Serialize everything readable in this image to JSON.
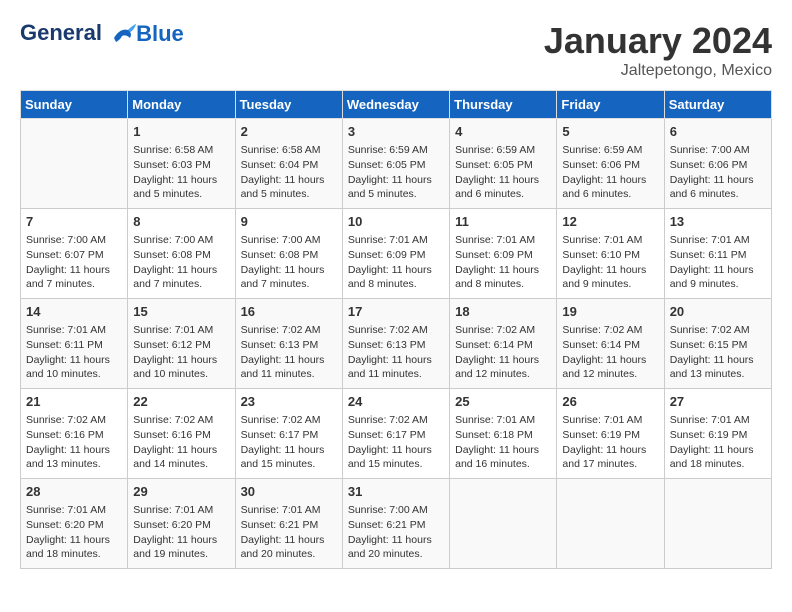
{
  "header": {
    "logo_line1": "General",
    "logo_line2": "Blue",
    "month": "January 2024",
    "location": "Jaltepetongo, Mexico"
  },
  "weekdays": [
    "Sunday",
    "Monday",
    "Tuesday",
    "Wednesday",
    "Thursday",
    "Friday",
    "Saturday"
  ],
  "weeks": [
    [
      {
        "day": "",
        "detail": ""
      },
      {
        "day": "1",
        "detail": "Sunrise: 6:58 AM\nSunset: 6:03 PM\nDaylight: 11 hours\nand 5 minutes."
      },
      {
        "day": "2",
        "detail": "Sunrise: 6:58 AM\nSunset: 6:04 PM\nDaylight: 11 hours\nand 5 minutes."
      },
      {
        "day": "3",
        "detail": "Sunrise: 6:59 AM\nSunset: 6:05 PM\nDaylight: 11 hours\nand 5 minutes."
      },
      {
        "day": "4",
        "detail": "Sunrise: 6:59 AM\nSunset: 6:05 PM\nDaylight: 11 hours\nand 6 minutes."
      },
      {
        "day": "5",
        "detail": "Sunrise: 6:59 AM\nSunset: 6:06 PM\nDaylight: 11 hours\nand 6 minutes."
      },
      {
        "day": "6",
        "detail": "Sunrise: 7:00 AM\nSunset: 6:06 PM\nDaylight: 11 hours\nand 6 minutes."
      }
    ],
    [
      {
        "day": "7",
        "detail": "Sunrise: 7:00 AM\nSunset: 6:07 PM\nDaylight: 11 hours\nand 7 minutes."
      },
      {
        "day": "8",
        "detail": "Sunrise: 7:00 AM\nSunset: 6:08 PM\nDaylight: 11 hours\nand 7 minutes."
      },
      {
        "day": "9",
        "detail": "Sunrise: 7:00 AM\nSunset: 6:08 PM\nDaylight: 11 hours\nand 7 minutes."
      },
      {
        "day": "10",
        "detail": "Sunrise: 7:01 AM\nSunset: 6:09 PM\nDaylight: 11 hours\nand 8 minutes."
      },
      {
        "day": "11",
        "detail": "Sunrise: 7:01 AM\nSunset: 6:09 PM\nDaylight: 11 hours\nand 8 minutes."
      },
      {
        "day": "12",
        "detail": "Sunrise: 7:01 AM\nSunset: 6:10 PM\nDaylight: 11 hours\nand 9 minutes."
      },
      {
        "day": "13",
        "detail": "Sunrise: 7:01 AM\nSunset: 6:11 PM\nDaylight: 11 hours\nand 9 minutes."
      }
    ],
    [
      {
        "day": "14",
        "detail": "Sunrise: 7:01 AM\nSunset: 6:11 PM\nDaylight: 11 hours\nand 10 minutes."
      },
      {
        "day": "15",
        "detail": "Sunrise: 7:01 AM\nSunset: 6:12 PM\nDaylight: 11 hours\nand 10 minutes."
      },
      {
        "day": "16",
        "detail": "Sunrise: 7:02 AM\nSunset: 6:13 PM\nDaylight: 11 hours\nand 11 minutes."
      },
      {
        "day": "17",
        "detail": "Sunrise: 7:02 AM\nSunset: 6:13 PM\nDaylight: 11 hours\nand 11 minutes."
      },
      {
        "day": "18",
        "detail": "Sunrise: 7:02 AM\nSunset: 6:14 PM\nDaylight: 11 hours\nand 12 minutes."
      },
      {
        "day": "19",
        "detail": "Sunrise: 7:02 AM\nSunset: 6:14 PM\nDaylight: 11 hours\nand 12 minutes."
      },
      {
        "day": "20",
        "detail": "Sunrise: 7:02 AM\nSunset: 6:15 PM\nDaylight: 11 hours\nand 13 minutes."
      }
    ],
    [
      {
        "day": "21",
        "detail": "Sunrise: 7:02 AM\nSunset: 6:16 PM\nDaylight: 11 hours\nand 13 minutes."
      },
      {
        "day": "22",
        "detail": "Sunrise: 7:02 AM\nSunset: 6:16 PM\nDaylight: 11 hours\nand 14 minutes."
      },
      {
        "day": "23",
        "detail": "Sunrise: 7:02 AM\nSunset: 6:17 PM\nDaylight: 11 hours\nand 15 minutes."
      },
      {
        "day": "24",
        "detail": "Sunrise: 7:02 AM\nSunset: 6:17 PM\nDaylight: 11 hours\nand 15 minutes."
      },
      {
        "day": "25",
        "detail": "Sunrise: 7:01 AM\nSunset: 6:18 PM\nDaylight: 11 hours\nand 16 minutes."
      },
      {
        "day": "26",
        "detail": "Sunrise: 7:01 AM\nSunset: 6:19 PM\nDaylight: 11 hours\nand 17 minutes."
      },
      {
        "day": "27",
        "detail": "Sunrise: 7:01 AM\nSunset: 6:19 PM\nDaylight: 11 hours\nand 18 minutes."
      }
    ],
    [
      {
        "day": "28",
        "detail": "Sunrise: 7:01 AM\nSunset: 6:20 PM\nDaylight: 11 hours\nand 18 minutes."
      },
      {
        "day": "29",
        "detail": "Sunrise: 7:01 AM\nSunset: 6:20 PM\nDaylight: 11 hours\nand 19 minutes."
      },
      {
        "day": "30",
        "detail": "Sunrise: 7:01 AM\nSunset: 6:21 PM\nDaylight: 11 hours\nand 20 minutes."
      },
      {
        "day": "31",
        "detail": "Sunrise: 7:00 AM\nSunset: 6:21 PM\nDaylight: 11 hours\nand 20 minutes."
      },
      {
        "day": "",
        "detail": ""
      },
      {
        "day": "",
        "detail": ""
      },
      {
        "day": "",
        "detail": ""
      }
    ]
  ]
}
